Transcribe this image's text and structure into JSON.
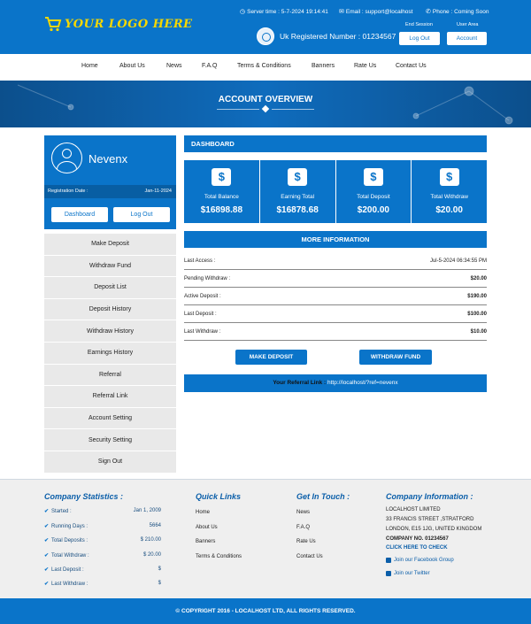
{
  "header": {
    "logo_text": "YOUR LOGO HERE",
    "server_time": "Server time : 5-7-2024 19:14:41",
    "email": "Email : support@localhost",
    "phone": "Phone : Coming Soon",
    "registered": "Uk Registered Number : 01234567",
    "end_session_label": "End Session",
    "user_area_label": "User Area",
    "logout_button": "Log Out",
    "account_button": "Account"
  },
  "nav": [
    "Home",
    "About Us",
    "News",
    "F.A.Q",
    "Terms & Conditions",
    "Banners",
    "Rate Us",
    "Contact Us"
  ],
  "banner_title": "ACCOUNT OVERVIEW",
  "profile": {
    "name": "Nevenx",
    "reg_label": "Registration Date :",
    "reg_date": "Jan-11-2024",
    "dashboard_button": "Dashboard",
    "logout_button": "Log Out"
  },
  "menu": [
    "Make Deposit",
    "Withdraw Fund",
    "Deposit List",
    "Deposit History",
    "Withdraw History",
    "Earnings History",
    "Referral",
    "Referral Link",
    "Account Setting",
    "Security Setting",
    "Sign Out"
  ],
  "dashboard_title": "DASHBOARD",
  "stats": [
    {
      "label": "Total Balance",
      "value": "$16898.88",
      "icon": "money-bill-icon",
      "glyph": "$"
    },
    {
      "label": "Earning Total",
      "value": "$16878.68",
      "icon": "briefcase-dollar-icon",
      "glyph": "$"
    },
    {
      "label": "Total Deposit",
      "value": "$200.00",
      "icon": "hand-money-icon",
      "glyph": "$"
    },
    {
      "label": "Total Withdraw",
      "value": "$20.00",
      "icon": "chart-dollar-icon",
      "glyph": "$"
    }
  ],
  "more_info_title": "MORE INFORMATION",
  "info": [
    {
      "key": "Last Access :",
      "value": "Jul-5-2024 06:34:55 PM"
    },
    {
      "key": "Pending Withdraw :",
      "value": "$20.00"
    },
    {
      "key": "Active Deposit :",
      "value": "$190.00"
    },
    {
      "key": "Last Deposit :",
      "value": "$100.00"
    },
    {
      "key": "Last Withdraw :",
      "value": "$10.00"
    }
  ],
  "actions": {
    "make_deposit": "MAKE DEPOSIT",
    "withdraw_fund": "WITHDRAW FUND"
  },
  "referral": {
    "label": "Your Referral Link :",
    "url": "http://localhost/?ref=nevenx"
  },
  "footer": {
    "stats_title": "Company Statistics :",
    "stats": [
      {
        "label": "Started :",
        "value": "Jan 1, 2009"
      },
      {
        "label": "Running Days :",
        "value": "5664"
      },
      {
        "label": "Total Deposits :",
        "value": "$ 210.00"
      },
      {
        "label": "Total Withdraw :",
        "value": "$ 20.00"
      },
      {
        "label": "Last Deposit :",
        "value": "$"
      },
      {
        "label": "Last Withdraw :",
        "value": "$"
      }
    ],
    "quick_title": "Quick Links",
    "quick_links": [
      "Home",
      "About Us",
      "Banners",
      "Terms & Conditions"
    ],
    "touch_title": "Get In Touch :",
    "touch_links": [
      "News",
      "F.A.Q",
      "Rate Us",
      "Contact Us"
    ],
    "company_title": "Company Information :",
    "company_lines": [
      "LOCALHOST LIMITED",
      "33 FRANCIS STREET ,STRATFORD",
      "LONDON, E15 1JG, UNITED KINGDOM"
    ],
    "company_no": "COMPANY NO. 01234567",
    "click_here": "CLICK HERE TO CHECK",
    "facebook": "Join our Facebook Group",
    "twitter": "Join our Twitter"
  },
  "copyright": "© COPYRIGHT 2016 - LOCALHOST LTD, ALL RIGHTS RESERVED."
}
